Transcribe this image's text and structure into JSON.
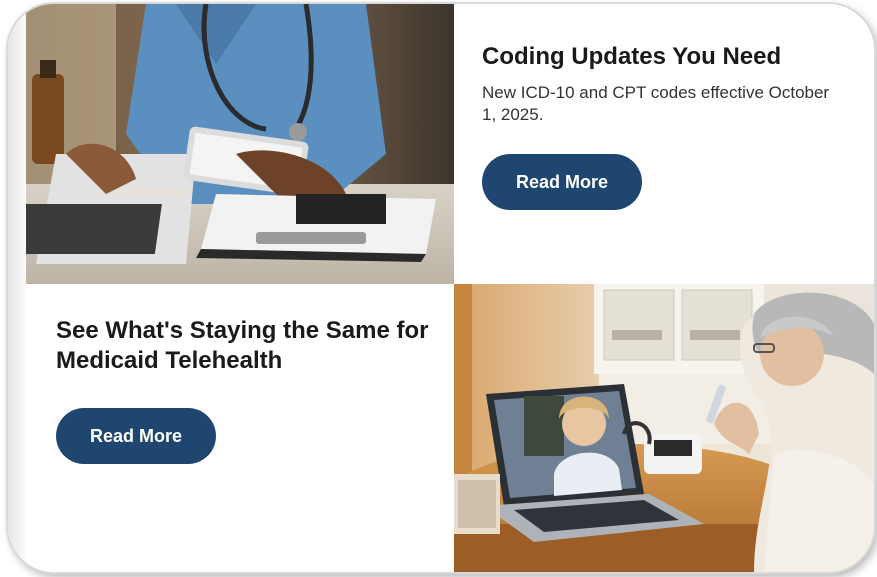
{
  "cards": {
    "coding_updates": {
      "title": "Coding Updates You Need",
      "description": "New ICD-10 and CPT codes effective October 1, 2025.",
      "button_label": "Read More",
      "image": "doctor-with-tablet-photo"
    },
    "telehealth": {
      "title": "See What's Staying the Same for Medicaid Telehealth",
      "button_label": "Read More",
      "image": "senior-telehealth-video-call-photo"
    }
  },
  "colors": {
    "button_bg": "#1f4670",
    "button_text": "#ffffff",
    "title_text": "#1a1a1a"
  }
}
